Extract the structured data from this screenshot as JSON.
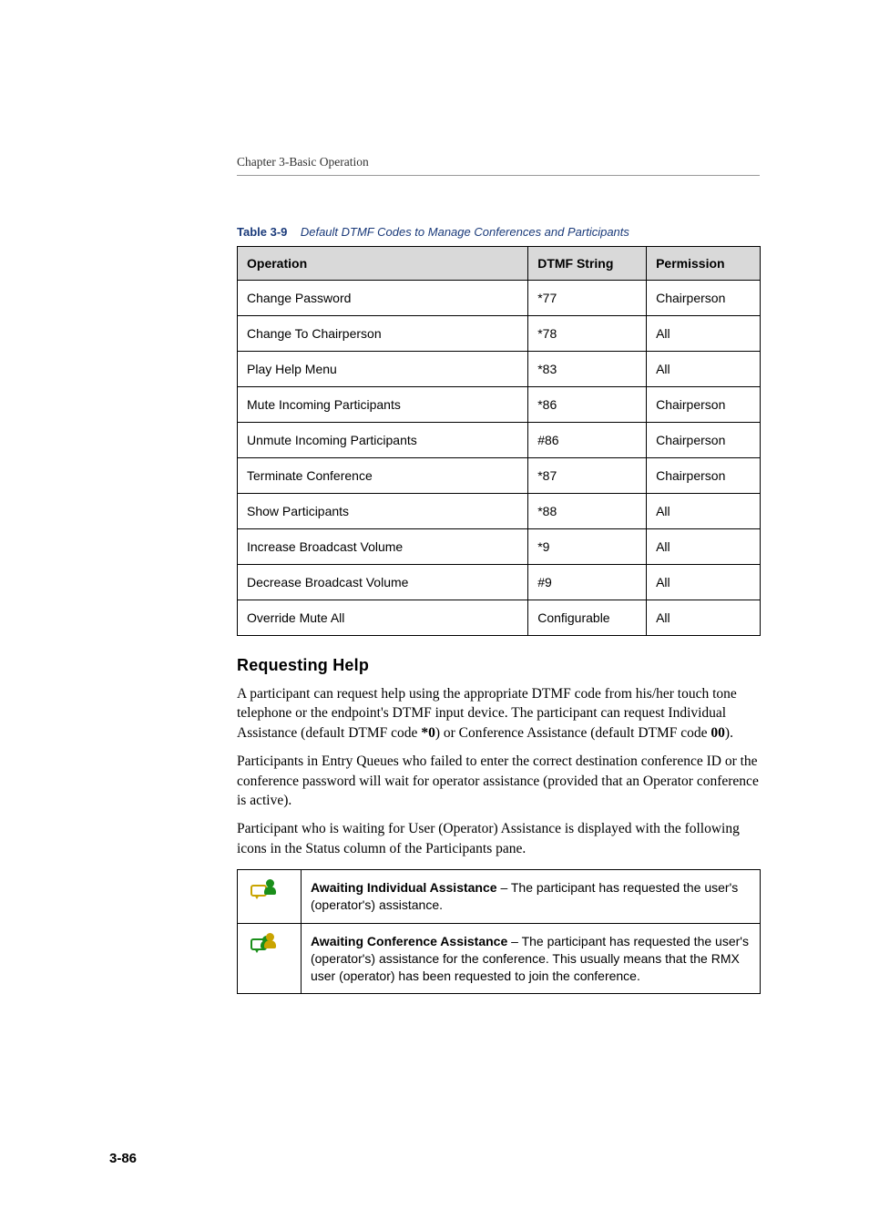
{
  "runningHead": "Chapter 3-Basic Operation",
  "tableCaption": {
    "label": "Table 3-9",
    "title": "Default DTMF Codes to Manage Conferences and Participants"
  },
  "dtmf": {
    "headers": {
      "op": "Operation",
      "str": "DTMF String",
      "perm": "Permission"
    },
    "rows": [
      {
        "op": "Change Password",
        "str": "*77",
        "perm": "Chairperson"
      },
      {
        "op": "Change To Chairperson",
        "str": "*78",
        "perm": "All"
      },
      {
        "op": "Play Help Menu",
        "str": "*83",
        "perm": "All"
      },
      {
        "op": "Mute Incoming Participants",
        "str": "*86",
        "perm": "Chairperson"
      },
      {
        "op": "Unmute Incoming Participants",
        "str": "#86",
        "perm": "Chairperson"
      },
      {
        "op": "Terminate Conference",
        "str": "*87",
        "perm": "Chairperson"
      },
      {
        "op": "Show Participants",
        "str": "*88",
        "perm": "All"
      },
      {
        "op": "Increase Broadcast Volume",
        "str": "*9",
        "perm": "All"
      },
      {
        "op": "Decrease Broadcast Volume",
        "str": "#9",
        "perm": "All"
      },
      {
        "op": "Override Mute All",
        "str": "Configurable",
        "perm": "All"
      }
    ]
  },
  "section": {
    "heading": "Requesting Help",
    "para1a": "A participant can request help using the appropriate DTMF code from his/her touch tone telephone or the endpoint's DTMF input device. The participant can request Individual Assistance (default DTMF code ",
    "code1": "*0",
    "para1b": ") or Conference Assistance (default DTMF code ",
    "code2": "00",
    "para1c": ").",
    "para2": "Participants in Entry Queues who failed to enter the correct destination conference ID or the conference password will wait for operator assistance (provided that an Operator conference is active).",
    "para3": "Participant who is waiting for User (Operator) Assistance is displayed with the following icons in the Status column of the Participants pane."
  },
  "iconTable": {
    "rows": [
      {
        "bold": "Awaiting Individual Assistance",
        "rest": " – The participant has requested the user's (operator's) assistance."
      },
      {
        "bold": "Awaiting Conference Assistance",
        "rest": " – The participant has requested the user's (operator's) assistance for the conference. This usually means that the RMX user (operator) has been requested to join the conference."
      }
    ]
  },
  "pageNumber": "3-86"
}
